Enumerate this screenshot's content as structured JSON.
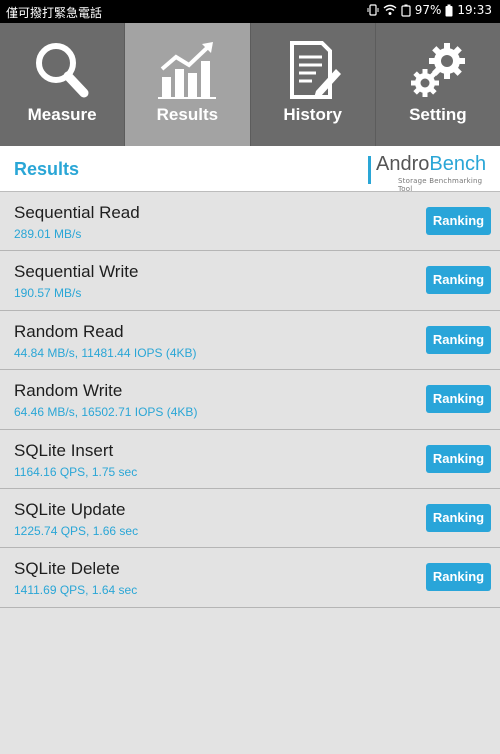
{
  "status_bar": {
    "carrier": "僅可撥打緊急電話",
    "battery": "97%",
    "time": "19:33"
  },
  "tabs": [
    {
      "label": "Measure",
      "icon": "magnifier-icon",
      "active": false
    },
    {
      "label": "Results",
      "icon": "chart-icon",
      "active": true
    },
    {
      "label": "History",
      "icon": "document-icon",
      "active": false
    },
    {
      "label": "Setting",
      "icon": "gears-icon",
      "active": false
    }
  ],
  "header": {
    "title": "Results",
    "logo_part1": "Andro",
    "logo_part2": "Bench",
    "logo_tagline": "Storage Benchmarking Tool"
  },
  "results": [
    {
      "name": "Sequential Read",
      "value": "289.01 MB/s",
      "button": "Ranking"
    },
    {
      "name": "Sequential Write",
      "value": "190.57 MB/s",
      "button": "Ranking"
    },
    {
      "name": "Random Read",
      "value": "44.84 MB/s, 11481.44 IOPS (4KB)",
      "button": "Ranking"
    },
    {
      "name": "Random Write",
      "value": "64.46 MB/s, 16502.71 IOPS (4KB)",
      "button": "Ranking"
    },
    {
      "name": "SQLite Insert",
      "value": "1164.16 QPS, 1.75 sec",
      "button": "Ranking"
    },
    {
      "name": "SQLite Update",
      "value": "1225.74 QPS, 1.66 sec",
      "button": "Ranking"
    },
    {
      "name": "SQLite Delete",
      "value": "1411.69 QPS, 1.64 sec",
      "button": "Ranking"
    }
  ],
  "colors": {
    "accent": "#2aa6d6",
    "tab_bg": "#6b6b6b",
    "tab_active": "#a3a3a3"
  }
}
